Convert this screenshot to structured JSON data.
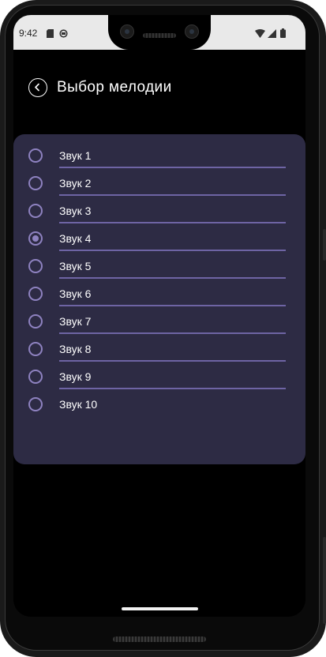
{
  "status_bar": {
    "time": "9:42",
    "icons": [
      "sd-card-icon",
      "sync-icon",
      "wifi-icon",
      "signal-icon",
      "battery-icon"
    ]
  },
  "app_bar": {
    "back_icon": "chevron-left-circle-icon",
    "title": "Выбор мелодии"
  },
  "sound_list": {
    "selected_index": 3,
    "items": [
      {
        "label": "Звук 1"
      },
      {
        "label": "Звук 2"
      },
      {
        "label": "Звук 3"
      },
      {
        "label": "Звук 4"
      },
      {
        "label": "Звук 5"
      },
      {
        "label": "Звук 6"
      },
      {
        "label": "Звук 7"
      },
      {
        "label": "Звук 8"
      },
      {
        "label": "Звук 9"
      },
      {
        "label": "Звук 10"
      }
    ]
  },
  "colors": {
    "background": "#000000",
    "card": "#2d2b44",
    "accent": "#8e82c0",
    "divider": "#6e64a4",
    "text": "#ffffff"
  }
}
